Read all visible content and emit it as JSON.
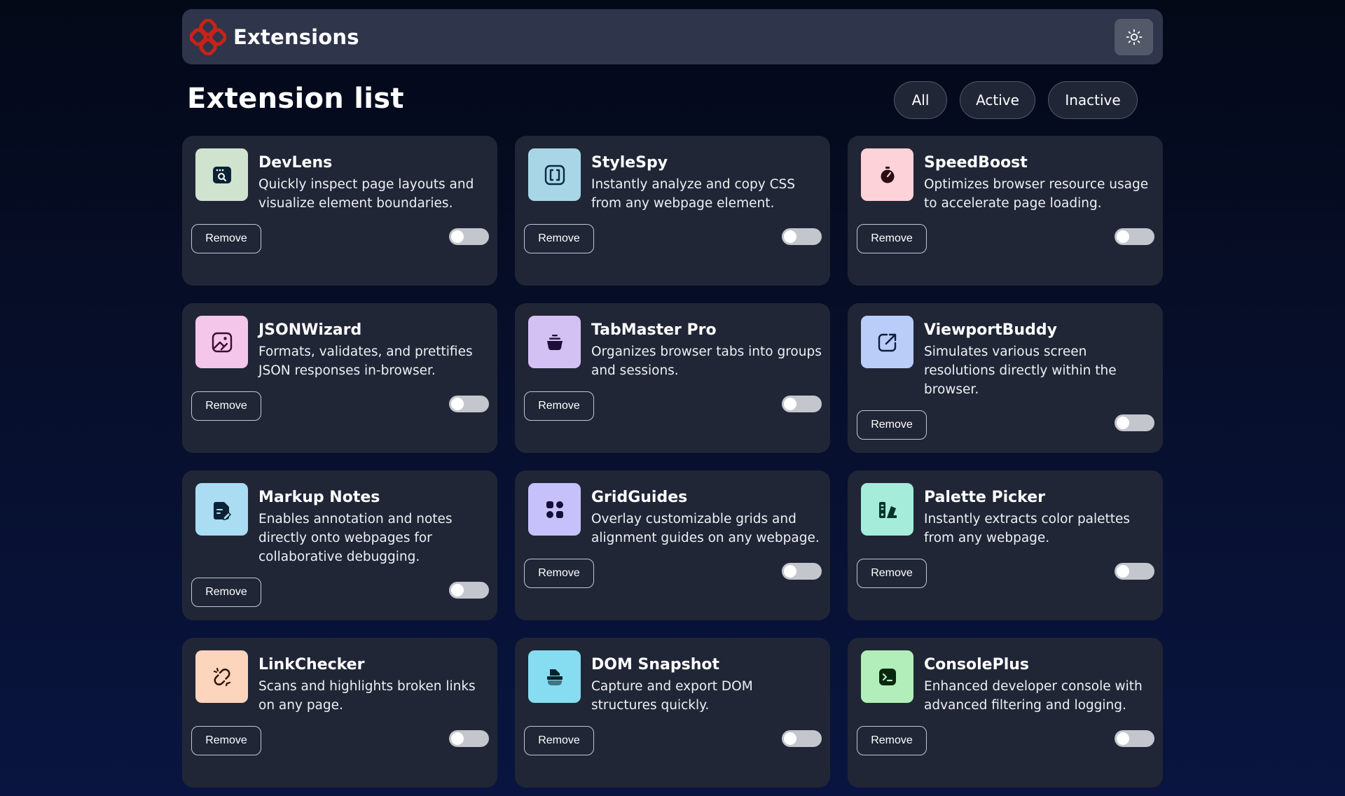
{
  "header": {
    "title": "Extensions",
    "logo": "extensions-logo",
    "theme_toggle": "sun-icon"
  },
  "list": {
    "title": "Extension list"
  },
  "filters": [
    {
      "label": "All"
    },
    {
      "label": "Active"
    },
    {
      "label": "Inactive"
    }
  ],
  "colors": {
    "accent": "#c7221a",
    "card": "#212636",
    "header": "#2f354b"
  },
  "extensions": [
    {
      "name": "DevLens",
      "description": "Quickly inspect page layouts and visualize element boundaries.",
      "remove_label": "Remove",
      "active": false,
      "icon": "window-search-icon",
      "icon_bg": "#cfe3cf"
    },
    {
      "name": "StyleSpy",
      "description": "Instantly analyze and copy CSS from any webpage element.",
      "remove_label": "Remove",
      "active": false,
      "icon": "brackets-icon",
      "icon_bg": "#a8d6e7"
    },
    {
      "name": "SpeedBoost",
      "description": "Optimizes browser resource usage to accelerate page loading.",
      "remove_label": "Remove",
      "active": false,
      "icon": "stopwatch-icon",
      "icon_bg": "#fdd2d9"
    },
    {
      "name": "JSONWizard",
      "description": "Formats, validates, and prettifies JSON responses in-browser.",
      "remove_label": "Remove",
      "active": false,
      "icon": "magic-image-icon",
      "icon_bg": "#f3c6ea"
    },
    {
      "name": "TabMaster Pro",
      "description": "Organizes browser tabs into groups and sessions.",
      "remove_label": "Remove",
      "active": false,
      "icon": "stack-icon",
      "icon_bg": "#d4c1f4"
    },
    {
      "name": "ViewportBuddy",
      "description": "Simulates various screen resolutions directly within the browser.",
      "remove_label": "Remove",
      "active": false,
      "icon": "resize-arrow-icon",
      "icon_bg": "#b9cdf8"
    },
    {
      "name": "Markup Notes",
      "description": "Enables annotation and notes directly onto webpages for collaborative debugging.",
      "remove_label": "Remove",
      "active": false,
      "icon": "note-pen-icon",
      "icon_bg": "#aadcf2"
    },
    {
      "name": "GridGuides",
      "description": "Overlay customizable grids and alignment guides on any webpage.",
      "remove_label": "Remove",
      "active": false,
      "icon": "grid-icon",
      "icon_bg": "#c6c1fb"
    },
    {
      "name": "Palette Picker",
      "description": "Instantly extracts color palettes from any webpage.",
      "remove_label": "Remove",
      "active": false,
      "icon": "palette-icon",
      "icon_bg": "#a5ecdb"
    },
    {
      "name": "LinkChecker",
      "description": "Scans and highlights broken links on any page.",
      "remove_label": "Remove",
      "active": false,
      "icon": "broken-link-icon",
      "icon_bg": "#fdd4bc"
    },
    {
      "name": "DOM Snapshot",
      "description": "Capture and export DOM structures quickly.",
      "remove_label": "Remove",
      "active": false,
      "icon": "camera-icon",
      "icon_bg": "#86dcf0"
    },
    {
      "name": "ConsolePlus",
      "description": "Enhanced developer console with advanced filtering and logging.",
      "remove_label": "Remove",
      "active": false,
      "icon": "terminal-icon",
      "icon_bg": "#b2eeb9"
    }
  ]
}
